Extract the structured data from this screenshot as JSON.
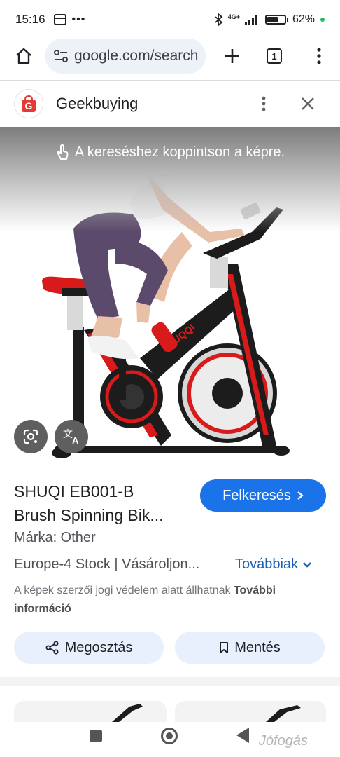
{
  "status_bar": {
    "time": "15:16",
    "network": "4G+",
    "battery_percent": "62%",
    "battery_level": 0.62
  },
  "browser": {
    "url": "google.com/search",
    "tab_count": "1",
    "icons": [
      "home-icon",
      "site-settings-icon",
      "plus-icon",
      "tabs-icon",
      "more-vert-icon"
    ]
  },
  "panel": {
    "site_name": "Geekbuying",
    "logo_letter": "G"
  },
  "image": {
    "tap_hint": "A kereséshez koppintson a képre.",
    "brand_on_frame": "SHUQQI",
    "translate_glyph": "A"
  },
  "product": {
    "title_line1": "SHUQI EB001-B",
    "title_line2": "Brush Spinning Bik...",
    "visit_label": "Felkeresés",
    "brand_line": "Márka: Other",
    "stock_line": "Europe-4 Stock | Vásároljon...",
    "more_label": "Továbbiak",
    "copyright_text": "A képek szerzői jogi védelem alatt állhatnak ",
    "copyright_link": "További információ",
    "share_label": "Megosztás",
    "save_label": "Mentés"
  },
  "watermark": "Jófogás",
  "colors": {
    "accent_blue": "#1a73e8",
    "chip_bg": "#e8f0fe",
    "logo_red": "#e53935",
    "bike_red": "#d91a1a",
    "bike_black": "#1c1c1c"
  }
}
